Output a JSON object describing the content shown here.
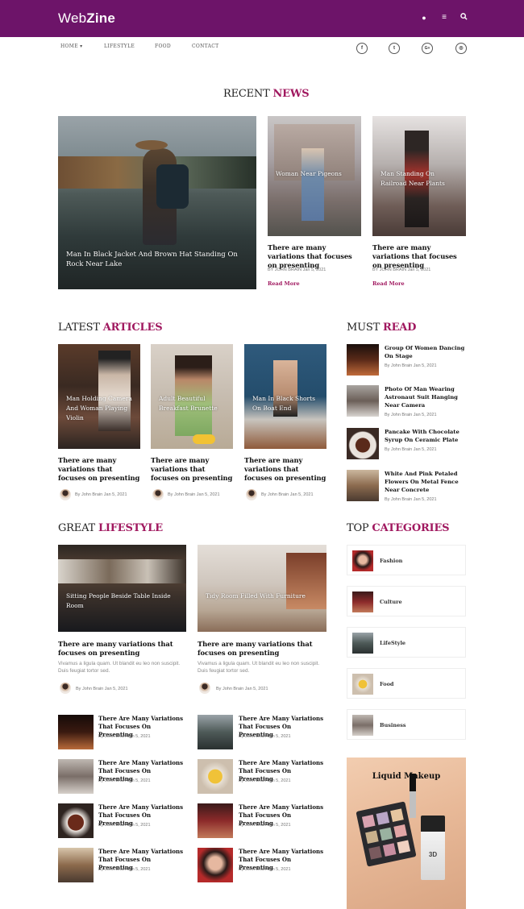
{
  "header": {
    "logo_part1": "Web",
    "logo_part2": "Zine"
  },
  "nav": [
    "HOME ▾",
    "LIFESTYLE",
    "FOOD",
    "CONTACT"
  ],
  "social": [
    "f",
    "t",
    "G+",
    "◎"
  ],
  "recent": {
    "title_a": "RECENT ",
    "title_b": "NEWS",
    "main": {
      "caption": "Man In Black Jacket And Brown Hat Standing On Rock Near Lake"
    },
    "cards": [
      {
        "caption": "Woman Near Pigeons",
        "title": "There are many variations that focuses on presenting",
        "meta": "BY JOHN BRAIN Jan 5, 2021",
        "read": "Read More"
      },
      {
        "caption": "Man Standing On Railroad Near Plants",
        "title": "There are many variations that focuses on presenting",
        "meta": "BY JOHN BRAIN Jan 5, 2021",
        "read": "Read More"
      }
    ]
  },
  "latest": {
    "title_a": "LATEST ",
    "title_b": "ARTICLES",
    "cards": [
      {
        "caption": "Man Holding Camera And Woman Playing Violin",
        "title": "There are many variations that focuses on presenting",
        "meta": "By John Brain Jan 5, 2021"
      },
      {
        "caption": "Adult Beautiful Breakfast Brunette",
        "title": "There are many variations that focuses on presenting",
        "meta": "By John Brain Jan 5, 2021"
      },
      {
        "caption": "Man In Black Shorts On Boat End",
        "title": "There are many variations that focuses on presenting",
        "meta": "By John Brain Jan 5, 2021"
      }
    ]
  },
  "mustread": {
    "title_a": "MUST ",
    "title_b": "READ",
    "items": [
      {
        "title": "Group Of Women Dancing On Stage",
        "meta": "By John Brain Jan 5, 2021"
      },
      {
        "title": "Photo Of Man Wearing Astronaut Suit Hanging Near Camera",
        "meta": "By John Brain Jan 5, 2021"
      },
      {
        "title": "Pancake With Chocolate Syrup On Ceramic Plate",
        "meta": "By John Brain Jan 5, 2021"
      },
      {
        "title": "White And Pink Petaled Flowers On Metal Fence Near Concrete",
        "meta": "By John Brain Jan 5, 2021"
      }
    ]
  },
  "lifestyle": {
    "title_a": "GREAT ",
    "title_b": "LIFESTYLE",
    "cards": [
      {
        "caption": "Sitting People Beside Table Inside Room",
        "title": "There are many variations that focuses on presenting",
        "excerpt": "Vivamus a ligula quam. Ut blandit eu leo non suscipit. Duis feugiat tortor sed.",
        "meta": "By John Brain Jan 5, 2021"
      },
      {
        "caption": "Tidy Room Filled With Furniture",
        "title": "There are many variations that focuses on presenting",
        "excerpt": "Vivamus a ligula quam. Ut blandit eu leo non suscipit. Duis feugiat tortor sed.",
        "meta": "By John Brain Jan 5, 2021"
      }
    ],
    "small": [
      {
        "title": "There Are Many Variations That Focuses On Presenting",
        "meta": "By John Brain Jan 5, 2021"
      },
      {
        "title": "There Are Many Variations That Focuses On Presenting",
        "meta": "By John Brain Jan 5, 2021"
      },
      {
        "title": "There Are Many Variations That Focuses On Presenting",
        "meta": "By John Brain Jan 5, 2021"
      },
      {
        "title": "There Are Many Variations That Focuses On Presenting",
        "meta": "By John Brain Jan 5, 2021"
      },
      {
        "title": "There Are Many Variations That Focuses On Presenting",
        "meta": "By John Brain Jan 5, 2021"
      },
      {
        "title": "There Are Many Variations That Focuses On Presenting",
        "meta": "By John Brain Jan 5, 2021"
      },
      {
        "title": "There Are Many Variations That Focuses On Presenting",
        "meta": "By John Brain Jan 5, 2021"
      },
      {
        "title": "There Are Many Variations That Focuses On Presenting",
        "meta": "By John Brain Jan 5, 2021"
      }
    ]
  },
  "categories": {
    "title_a": "TOP ",
    "title_b": "CATEGORIES",
    "items": [
      "Fashion",
      "Culture",
      "LifeStyle",
      "Food",
      "Business"
    ]
  },
  "ad": {
    "title": "Liquid Makeup",
    "label": "3D"
  },
  "colors": {
    "brand": "#6d1469",
    "accent": "#a0185f"
  }
}
